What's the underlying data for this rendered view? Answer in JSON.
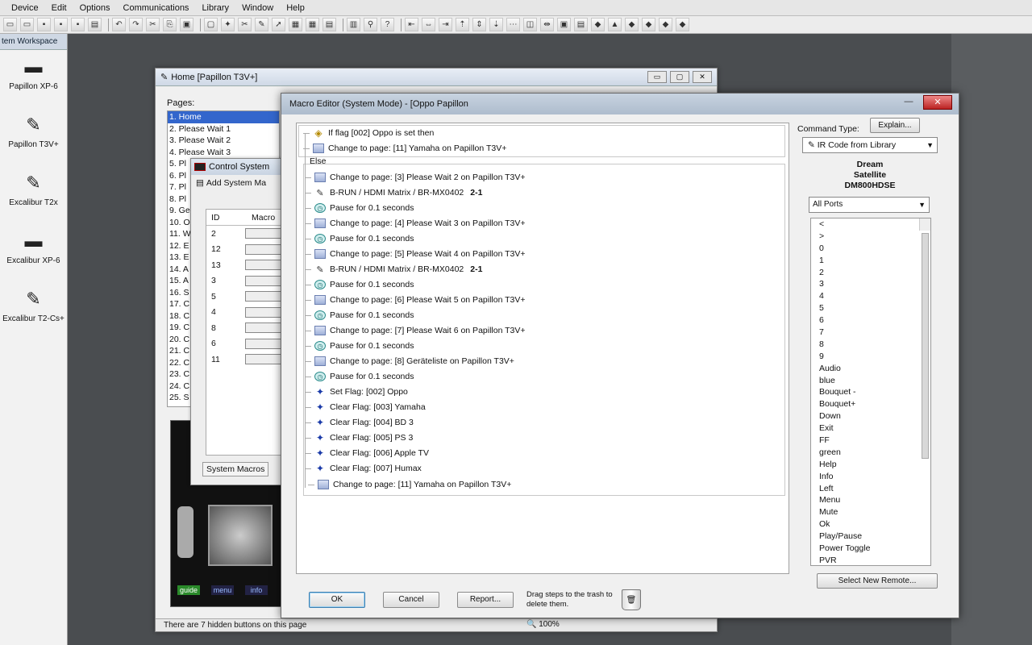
{
  "menubar": [
    "Device",
    "Edit",
    "Options",
    "Communications",
    "Library",
    "Window",
    "Help"
  ],
  "toolbar_icons": [
    "open-icon",
    "folder-icon",
    "save-icon",
    "save-all-icon",
    "disk-icon",
    "print-icon",
    "undo-icon",
    "redo-icon",
    "cut-icon",
    "copy-icon",
    "paste-icon",
    "new-page-icon",
    "wand-icon",
    "scissor-icon",
    "edit-icon",
    "pointer-icon",
    "duplicate-icon",
    "grid-icon",
    "pages-icon",
    "layout-icon",
    "zoom-icon",
    "help-pointer-icon",
    "align-left-icon",
    "align-center-icon",
    "align-right-icon",
    "align-top-icon",
    "align-middle-icon",
    "align-bottom-icon",
    "distribute-icon",
    "size-icon",
    "spacing-icon",
    "group-icon",
    "ungroup-icon",
    "lock-icon",
    "order-icon",
    "arrow-up-icon",
    "arrow-down-icon",
    "arrow-left-icon",
    "arrow-right-icon"
  ],
  "workspace": {
    "title": "tem Workspace",
    "devices": [
      {
        "label": "Papillon XP-6",
        "icon": "remote-xp-icon"
      },
      {
        "label": "Papillon T3V+",
        "icon": "remote-t3v-icon"
      },
      {
        "label": "Excalibur T2x",
        "icon": "remote-t2x-icon"
      },
      {
        "label": "Excalibur XP-6",
        "icon": "remote-excalibur-xp-icon"
      },
      {
        "label": "Excalibur T2-Cs+",
        "icon": "remote-t2cs-icon"
      }
    ]
  },
  "home_window": {
    "title": "Home [Papillon T3V+]",
    "pages_label": "Pages:",
    "pages": [
      "1. Home",
      "2. Please Wait 1",
      "3. Please Wait 2",
      "4. Please Wait 3",
      "5. Pl",
      "6. Pl",
      "7. Pl",
      "8. Pl",
      "9. Ge",
      "10. O",
      "11. W",
      "12. E",
      "13. E",
      "14. A",
      "15. A",
      "16. S",
      "17. C",
      "18. C",
      "19. C",
      "20. C",
      "21. C",
      "22. C",
      "23. C",
      "24. C",
      "25. S"
    ],
    "status": "There are 7 hidden buttons on this page",
    "zoom": "100%",
    "preview_buttons": [
      "guide",
      "menu",
      "info"
    ]
  },
  "control_window": {
    "title": "Control System",
    "subtitle": "Add System Ma",
    "col_id": "ID",
    "col_macro": "Macro",
    "ids": [
      "2",
      "12",
      "13",
      "3",
      "5",
      "4",
      "8",
      "6",
      "11"
    ],
    "tab": "System Macros"
  },
  "macro_editor": {
    "title": "Macro Editor (System Mode) - [Oppo Papillon",
    "min_label": "—",
    "close_label": "✕",
    "condition": "If flag [002] Oppo is set then",
    "then_step": "Change to page: [11] Yamaha on Papillon T3V+",
    "else_label": "Else",
    "steps": [
      {
        "type": "page",
        "text": "Change to page: [3] Please Wait 2 on Papillon T3V+"
      },
      {
        "type": "ir",
        "text": "B-RUN / HDMI Matrix / BR-MX0402",
        "extra": "2-1"
      },
      {
        "type": "pause",
        "text": "Pause for 0.1 seconds"
      },
      {
        "type": "page",
        "text": "Change to page: [4] Please Wait 3 on Papillon T3V+"
      },
      {
        "type": "pause",
        "text": "Pause for 0.1 seconds"
      },
      {
        "type": "page",
        "text": "Change to page: [5] Please Wait 4 on Papillon T3V+"
      },
      {
        "type": "ir",
        "text": "B-RUN / HDMI Matrix / BR-MX0402",
        "extra": "2-1"
      },
      {
        "type": "pause",
        "text": "Pause for 0.1 seconds"
      },
      {
        "type": "page",
        "text": "Change to page: [6] Please Wait 5 on Papillon T3V+"
      },
      {
        "type": "pause",
        "text": "Pause for 0.1 seconds"
      },
      {
        "type": "page",
        "text": "Change to page: [7] Please Wait 6 on Papillon T3V+"
      },
      {
        "type": "pause",
        "text": "Pause for 0.1 seconds"
      },
      {
        "type": "page",
        "text": "Change to page: [8] Geräteliste on Papillon T3V+"
      },
      {
        "type": "pause",
        "text": "Pause for 0.1 seconds"
      },
      {
        "type": "flag",
        "text": "Set Flag: [002] Oppo"
      },
      {
        "type": "flag",
        "text": "Clear Flag: [003] Yamaha"
      },
      {
        "type": "flag",
        "text": "Clear Flag: [004] BD 3"
      },
      {
        "type": "flag",
        "text": "Clear Flag: [005] PS 3"
      },
      {
        "type": "flag",
        "text": "Clear Flag: [006] Apple TV"
      },
      {
        "type": "flag",
        "text": "Clear Flag: [007] Humax"
      }
    ],
    "final_step": "Change to page: [11] Yamaha on Papillon T3V+",
    "buttons": {
      "ok": "OK",
      "cancel": "Cancel",
      "report": "Report..."
    },
    "trash_hint": "Drag steps to the trash to delete them.",
    "command_type_label": "Command Type:",
    "explain_label": "Explain...",
    "command_type_value": "IR Code from Library",
    "device_lines": [
      "Dream",
      "Satellite",
      "DM800HDSE"
    ],
    "ports_value": "All Ports",
    "commands": [
      "<",
      ">",
      "0",
      "1",
      "2",
      "3",
      "4",
      "5",
      "6",
      "7",
      "8",
      "9",
      "Audio",
      "blue",
      "Bouquet -",
      "Bouquet+",
      "Down",
      "Exit",
      "FF",
      "green",
      "Help",
      "Info",
      "Left",
      "Menu",
      "Mute",
      "Ok",
      "Play/Pause",
      "Power Toggle",
      "PVR"
    ],
    "select_remote_label": "Select New Remote..."
  }
}
